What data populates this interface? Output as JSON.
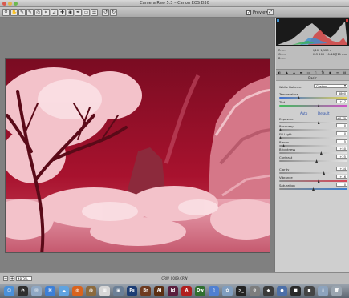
{
  "window": {
    "title": "Camera Raw 5.3  –  Canon EOS D30"
  },
  "toolbar": {
    "tools": [
      {
        "name": "zoom-tool-icon",
        "glyph": "⚲"
      },
      {
        "name": "hand-tool-icon",
        "glyph": "✋"
      },
      {
        "name": "white-balance-tool-icon",
        "glyph": "✎"
      },
      {
        "name": "color-sampler-tool-icon",
        "glyph": "✎"
      },
      {
        "name": "targeted-adjustment-tool-icon",
        "glyph": "◎"
      },
      {
        "name": "crop-tool-icon",
        "glyph": "⌗"
      },
      {
        "name": "straighten-tool-icon",
        "glyph": "⊿"
      },
      {
        "name": "spot-removal-tool-icon",
        "glyph": "✚"
      },
      {
        "name": "red-eye-tool-icon",
        "glyph": "◉"
      },
      {
        "name": "adjustment-brush-icon",
        "glyph": "✒"
      },
      {
        "name": "graduated-filter-icon",
        "glyph": "▭"
      },
      {
        "name": "preferences-icon",
        "glyph": "☰"
      },
      {
        "name": "rotate-left-icon",
        "glyph": "↺"
      },
      {
        "name": "rotate-right-icon",
        "glyph": "↻"
      }
    ],
    "preview_label": "Preview",
    "preview_checked": "✓"
  },
  "info": {
    "r": "R:",
    "g": "G:",
    "b": "B:",
    "r_val": "---",
    "g_val": "---",
    "b_val": "---",
    "aperture": "f/10",
    "shutter": "1/125 s",
    "iso": "ISO 200",
    "lens": "11-18@11 mm"
  },
  "panel": {
    "section_title": "Basic",
    "white_balance": {
      "label": "White Balance:",
      "value": "Custom"
    },
    "auto_label": "Auto",
    "default_label": "Default",
    "sliders": [
      {
        "key": "temperature",
        "label": "Temperature",
        "value": "3800",
        "pos": 0.28,
        "track": "temp"
      },
      {
        "key": "tint",
        "label": "Tint",
        "value": "+17",
        "pos": 0.58,
        "track": "tint"
      },
      {
        "key": "exposure",
        "label": "Exposure",
        "value": "+0.70",
        "pos": 0.58,
        "track": "gray"
      },
      {
        "key": "recovery",
        "label": "Recovery",
        "value": "0",
        "pos": 0.0,
        "track": "gray"
      },
      {
        "key": "fill-light",
        "label": "Fill Light",
        "value": "0",
        "pos": 0.0,
        "track": "gray"
      },
      {
        "key": "blacks",
        "label": "Blacks",
        "value": "5",
        "pos": 0.05,
        "track": "gray"
      },
      {
        "key": "brightness",
        "label": "Brightness",
        "value": "+50",
        "pos": 0.62,
        "track": "gray"
      },
      {
        "key": "contrast",
        "label": "Contrast",
        "value": "+25",
        "pos": 0.55,
        "track": "gray"
      },
      {
        "key": "clarity",
        "label": "Clarity",
        "value": "+34",
        "pos": 0.66,
        "track": "gray"
      },
      {
        "key": "vibrance",
        "label": "Vibrance",
        "value": "+16",
        "pos": 0.58,
        "track": "vib"
      },
      {
        "key": "saturation",
        "label": "Saturation",
        "value": "0",
        "pos": 0.5,
        "track": "sat"
      }
    ]
  },
  "status": {
    "zoom_value": "48.3%",
    "filename": "CRW_0009.CRW"
  },
  "colors": {
    "photo_sky": "#a8122e",
    "photo_foliage": "#f3b4bf",
    "accent_blue": "#2b4fa8"
  },
  "dock": {
    "icons": [
      {
        "name": "finder-icon",
        "glyph": "☺",
        "color": "#4a90d9"
      },
      {
        "name": "dashboard-icon",
        "glyph": "◔",
        "color": "#2e2e2e"
      },
      {
        "name": "mail-icon",
        "glyph": "✉",
        "color": "#8fa8c4"
      },
      {
        "name": "safari-icon",
        "glyph": "⌘",
        "color": "#3d7fd6"
      },
      {
        "name": "ichat-icon",
        "glyph": "☁",
        "color": "#5fa3e0"
      },
      {
        "name": "firefox-icon",
        "glyph": "◍",
        "color": "#d9631d"
      },
      {
        "name": "address-book-icon",
        "glyph": "@",
        "color": "#8b6a3e"
      },
      {
        "name": "ical-icon",
        "glyph": "▦",
        "color": "#d6d6d6"
      },
      {
        "name": "preview-icon",
        "glyph": "▣",
        "color": "#6b7f96"
      },
      {
        "name": "photoshop-icon",
        "glyph": "Ps",
        "color": "#1c3d74"
      },
      {
        "name": "bridge-icon",
        "glyph": "Br",
        "color": "#6e3a1f"
      },
      {
        "name": "illustrator-icon",
        "glyph": "Ai",
        "color": "#5b2f12"
      },
      {
        "name": "indesign-icon",
        "glyph": "Id",
        "color": "#5a1e3d"
      },
      {
        "name": "acrobat-icon",
        "glyph": "A",
        "color": "#b01e1e"
      },
      {
        "name": "dreamweaver-icon",
        "glyph": "Dw",
        "color": "#2f6f2f"
      },
      {
        "name": "itunes-icon",
        "glyph": "♫",
        "color": "#4f7fd1"
      },
      {
        "name": "iphoto-icon",
        "glyph": "✿",
        "color": "#7f9dbf"
      },
      {
        "name": "terminal-icon",
        "glyph": ">_",
        "color": "#222"
      },
      {
        "name": "system-preferences-icon",
        "glyph": "⚙",
        "color": "#7d7d7d"
      },
      {
        "name": "app-icon-1",
        "glyph": "◆",
        "color": "#3b3b3b"
      },
      {
        "name": "app-icon-2",
        "glyph": "●",
        "color": "#4c6fa8"
      },
      {
        "name": "app-icon-3",
        "glyph": "■",
        "color": "#2a2a2a"
      },
      {
        "name": "app-icon-4",
        "glyph": "◼",
        "color": "#444"
      },
      {
        "name": "downloads-stack-icon",
        "glyph": "⇩",
        "color": "#8da3bd"
      },
      {
        "name": "trash-icon",
        "glyph": "🗑",
        "color": "#9aa5b0"
      }
    ]
  }
}
